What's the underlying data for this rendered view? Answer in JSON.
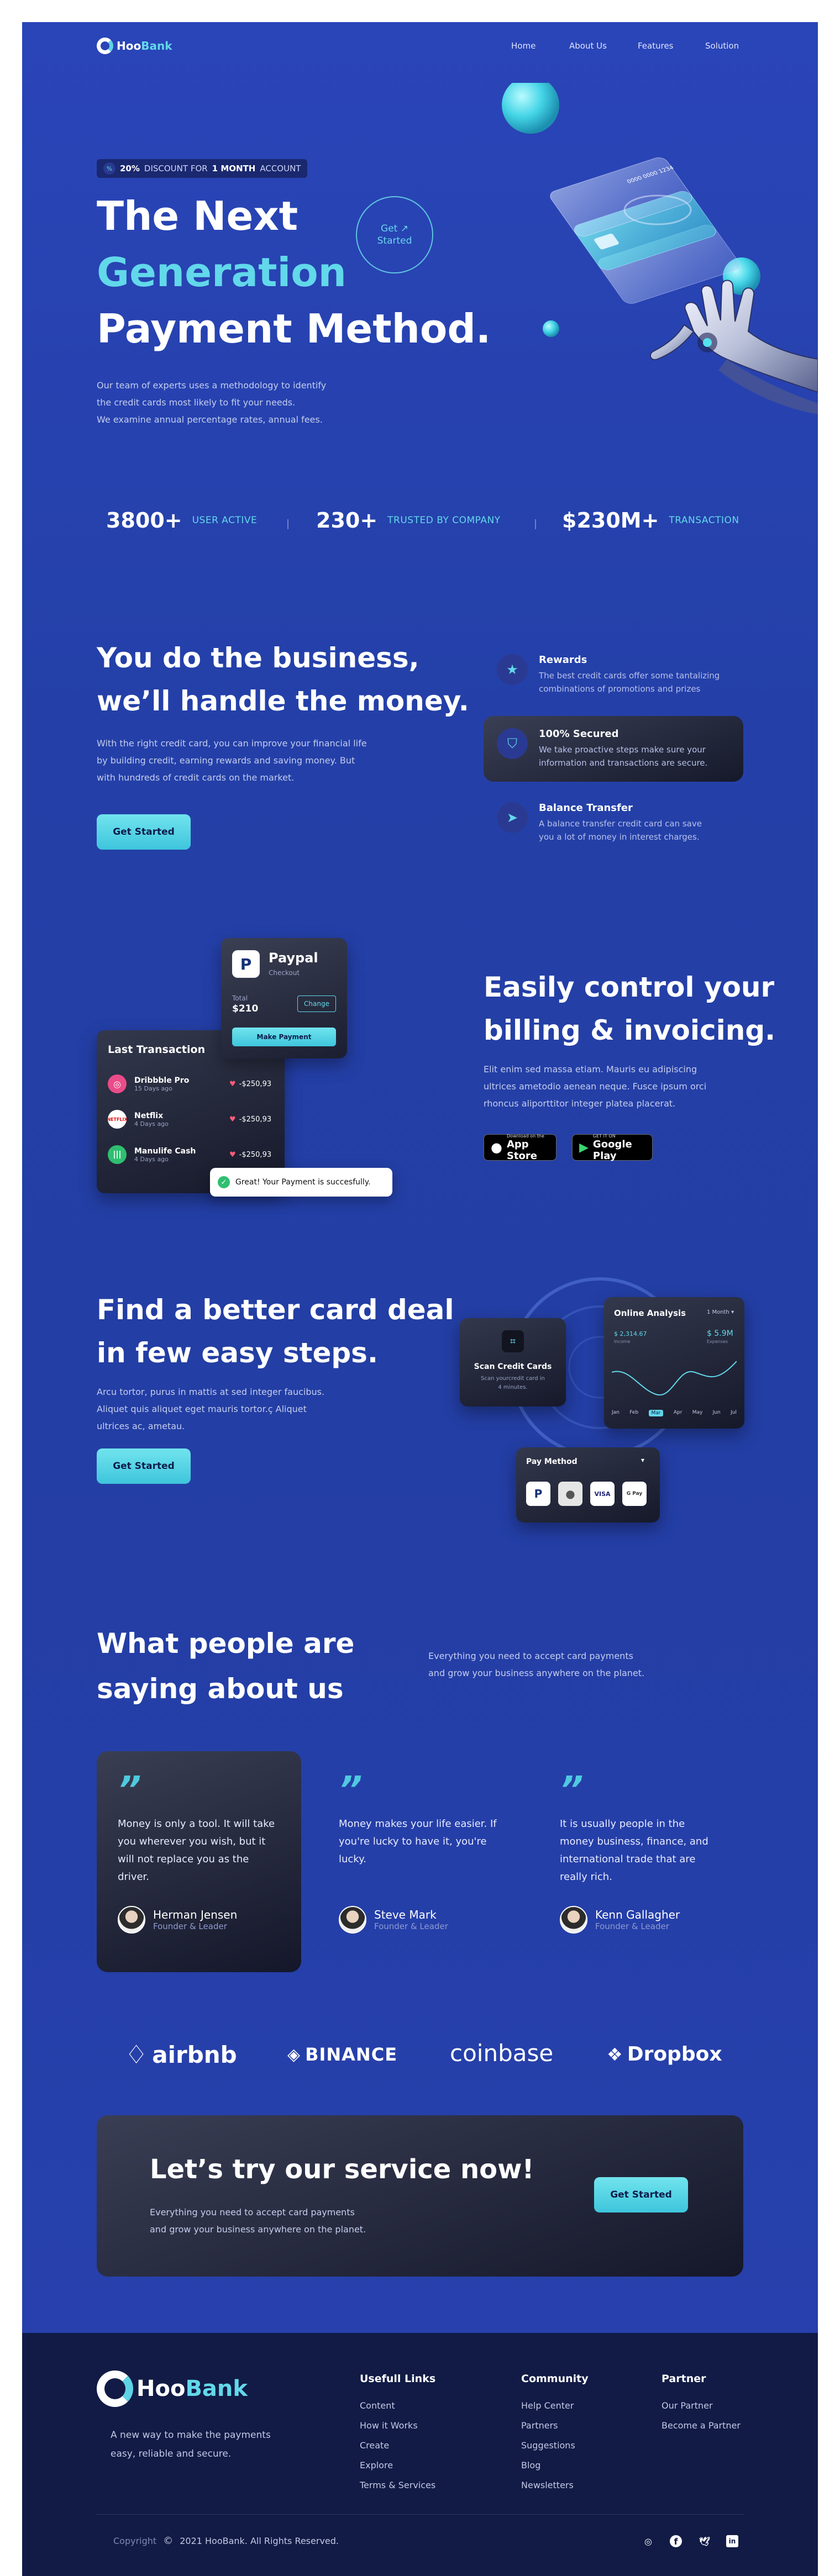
{
  "brand": {
    "name_a": "Hoo",
    "name_b": "Bank"
  },
  "nav": {
    "items": [
      "Home",
      "About Us",
      "Features",
      "Solution"
    ]
  },
  "hero": {
    "badge_pct": "20%",
    "badge_mid": "DISCOUNT FOR",
    "badge_month": "1 MONTH",
    "badge_end": "ACCOUNT",
    "title_1": "The Next",
    "title_2": "Generation",
    "title_3": "Payment Method.",
    "cta_line1": "Get ↗",
    "cta_line2": "Started",
    "para_1": "Our team of experts uses a methodology to identify",
    "para_2": "the credit cards most likely to fit your needs.",
    "para_3": "We examine annual percentage rates, annual fees."
  },
  "stats": [
    {
      "num": "3800+",
      "label": "USER ACTIVE"
    },
    {
      "num": "230+",
      "label": "TRUSTED BY COMPANY"
    },
    {
      "num": "$230M+",
      "label": "TRANSACTION"
    }
  ],
  "business": {
    "title_1": "You do the business,",
    "title_2": "we’ll handle the money.",
    "para_1": "With the right credit card, you can improve your financial life",
    "para_2": "by building credit, earning rewards and saving money. But",
    "para_3": "with hundreds of credit cards on the market.",
    "button": "Get Started",
    "features": [
      {
        "title": "Rewards",
        "text_1": "The best credit cards offer some tantalizing",
        "text_2": "combinations of promotions and prizes"
      },
      {
        "title": "100% Secured",
        "text_1": "We take proactive steps make sure your",
        "text_2": "information and transactions are secure."
      },
      {
        "title": "Balance Transfer",
        "text_1": "A balance transfer credit card can save",
        "text_2": "you a lot of money in interest charges."
      }
    ]
  },
  "billing": {
    "paypal_title": "Paypal",
    "paypal_sub": "Checkout",
    "total_label": "Total",
    "total_value": "$210",
    "change": "Change",
    "make_payment": "Make Payment",
    "last_tx_title": "Last Transaction",
    "transactions": [
      {
        "name": "Dribbble Pro",
        "date": "15 Days ago",
        "amount": "-$250,93"
      },
      {
        "name": "Netflix",
        "date": "4 Days ago",
        "amount": "-$250,93"
      },
      {
        "name": "Manulife Cash",
        "date": "4 Days ago",
        "amount": "-$250,93"
      }
    ],
    "toast": "Great! Your Payment is succesfully.",
    "title_1": "Easily control your",
    "title_2": "billing & invoicing.",
    "para_1": "Elit enim sed massa etiam. Mauris eu adipiscing",
    "para_2": "ultrices ametodio aenean neque. Fusce ipsum orci",
    "para_3": "rhoncus aliporttitor integer platea placerat.",
    "appstore_small": "Download on the",
    "appstore_big": "App Store",
    "gplay_small": "GET IT ON",
    "gplay_big": "Google Play"
  },
  "steps": {
    "title_1": "Find a better card deal",
    "title_2": "in few easy steps.",
    "para_1": "Arcu tortor, purus in mattis at sed integer faucibus.",
    "para_2": "Aliquet quis aliquet eget mauris tortor.ç Aliquet",
    "para_3": "ultrices ac, ametau.",
    "button": "Get Started",
    "scan_title": "Scan Credit Cards",
    "scan_sub_1": "Scan yourcredit card in",
    "scan_sub_2": "4 minutes.",
    "analysis_title": "Online Analysis",
    "analysis_period": "1 Month",
    "analysis_v1": "$ 2,314.67",
    "analysis_l1": "Income",
    "analysis_v2": "$ 5.9M",
    "analysis_l2": "Expenses",
    "months": [
      "Jan",
      "Feb",
      "Mar",
      "Apr",
      "May",
      "Jun",
      "Jul"
    ],
    "paymethod_title": "Pay Method",
    "pay_cards": [
      "P",
      "",
      "VISA",
      "G Pay"
    ]
  },
  "testimonials": {
    "title_1": "What people are",
    "title_2": "saying about us",
    "para_1": "Everything you need to accept card payments",
    "para_2": "and grow your business anywhere on the planet.",
    "items": [
      {
        "text_1": "Money is only a tool. It will take",
        "text_2": "you wherever you wish, but it",
        "text_3": "will not replace you as the",
        "text_4": "driver.",
        "name": "Herman Jensen",
        "role": "Founder & Leader"
      },
      {
        "text_1": "Money makes your life easier. If",
        "text_2": "you're lucky to have it, you're",
        "text_3": "lucky.",
        "text_4": "",
        "name": "Steve Mark",
        "role": "Founder & Leader"
      },
      {
        "text_1": "It is usually people in the",
        "text_2": "money business, finance, and",
        "text_3": "international trade that are",
        "text_4": "really rich.",
        "name": "Kenn Gallagher",
        "role": "Founder & Leader"
      }
    ]
  },
  "partners": [
    "airbnb",
    "BINANCE",
    "coinbase",
    "Dropbox"
  ],
  "cta": {
    "title": "Let’s try our service now!",
    "para_1": "Everything you need to accept card payments",
    "para_2": "and grow your business anywhere on the planet.",
    "button": "Get Started"
  },
  "footer": {
    "tagline_1": "A new way to make the payments",
    "tagline_2": "easy, reliable and secure.",
    "cols": [
      {
        "title": "Usefull Links",
        "links": [
          "Content",
          "How it Works",
          "Create",
          "Explore",
          "Terms & Services"
        ]
      },
      {
        "title": "Community",
        "links": [
          "Help Center",
          "Partners",
          "Suggestions",
          "Blog",
          "Newsletters"
        ]
      },
      {
        "title": "Partner",
        "links": [
          "Our Partner",
          "Become a Partner"
        ]
      }
    ],
    "copyright_a": "Copyright",
    "copyright_b": "2021 HooBank. All Rights Reserved.",
    "socials": [
      "instagram",
      "facebook",
      "twitter",
      "linkedin"
    ]
  },
  "colors": {
    "accent": "#62d8ea",
    "background": "#2440a8",
    "footer": "#111b45",
    "dark_card": "#1a1d2e"
  }
}
